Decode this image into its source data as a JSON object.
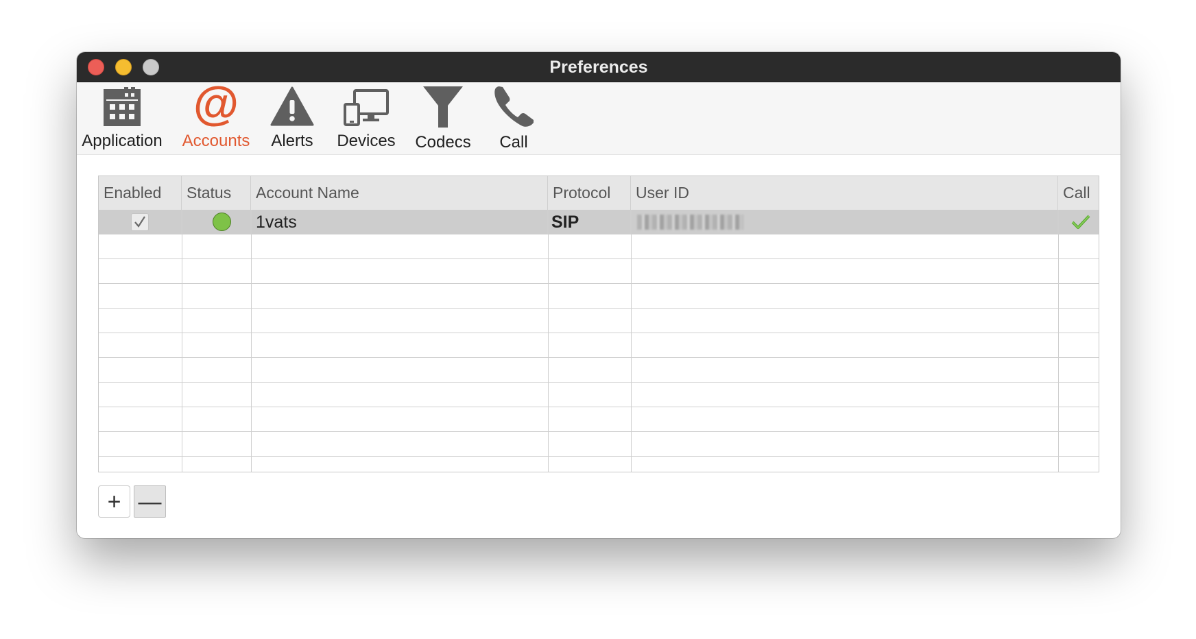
{
  "window": {
    "title": "Preferences"
  },
  "toolbar": {
    "items": [
      {
        "label": "Application",
        "icon": "calendar-grid-icon",
        "active": false
      },
      {
        "label": "Accounts",
        "icon": "at-sign-icon",
        "active": true
      },
      {
        "label": "Alerts",
        "icon": "warning-triangle-icon",
        "active": false
      },
      {
        "label": "Devices",
        "icon": "devices-icon",
        "active": false
      },
      {
        "label": "Codecs",
        "icon": "funnel-icon",
        "active": false
      },
      {
        "label": "Call",
        "icon": "phone-icon",
        "active": false
      }
    ],
    "active_color": "#e1582f"
  },
  "accounts_table": {
    "columns": [
      "Enabled",
      "Status",
      "Account Name",
      "Protocol",
      "User ID",
      "Call"
    ],
    "rows": [
      {
        "enabled": true,
        "status": "online",
        "account_name": "1vats",
        "protocol": "SIP",
        "user_id": "",
        "call": true
      }
    ]
  },
  "buttons": {
    "add": "+",
    "remove": "—"
  },
  "colors": {
    "status_online": "#7ec247",
    "call_check": "#5aa833"
  }
}
